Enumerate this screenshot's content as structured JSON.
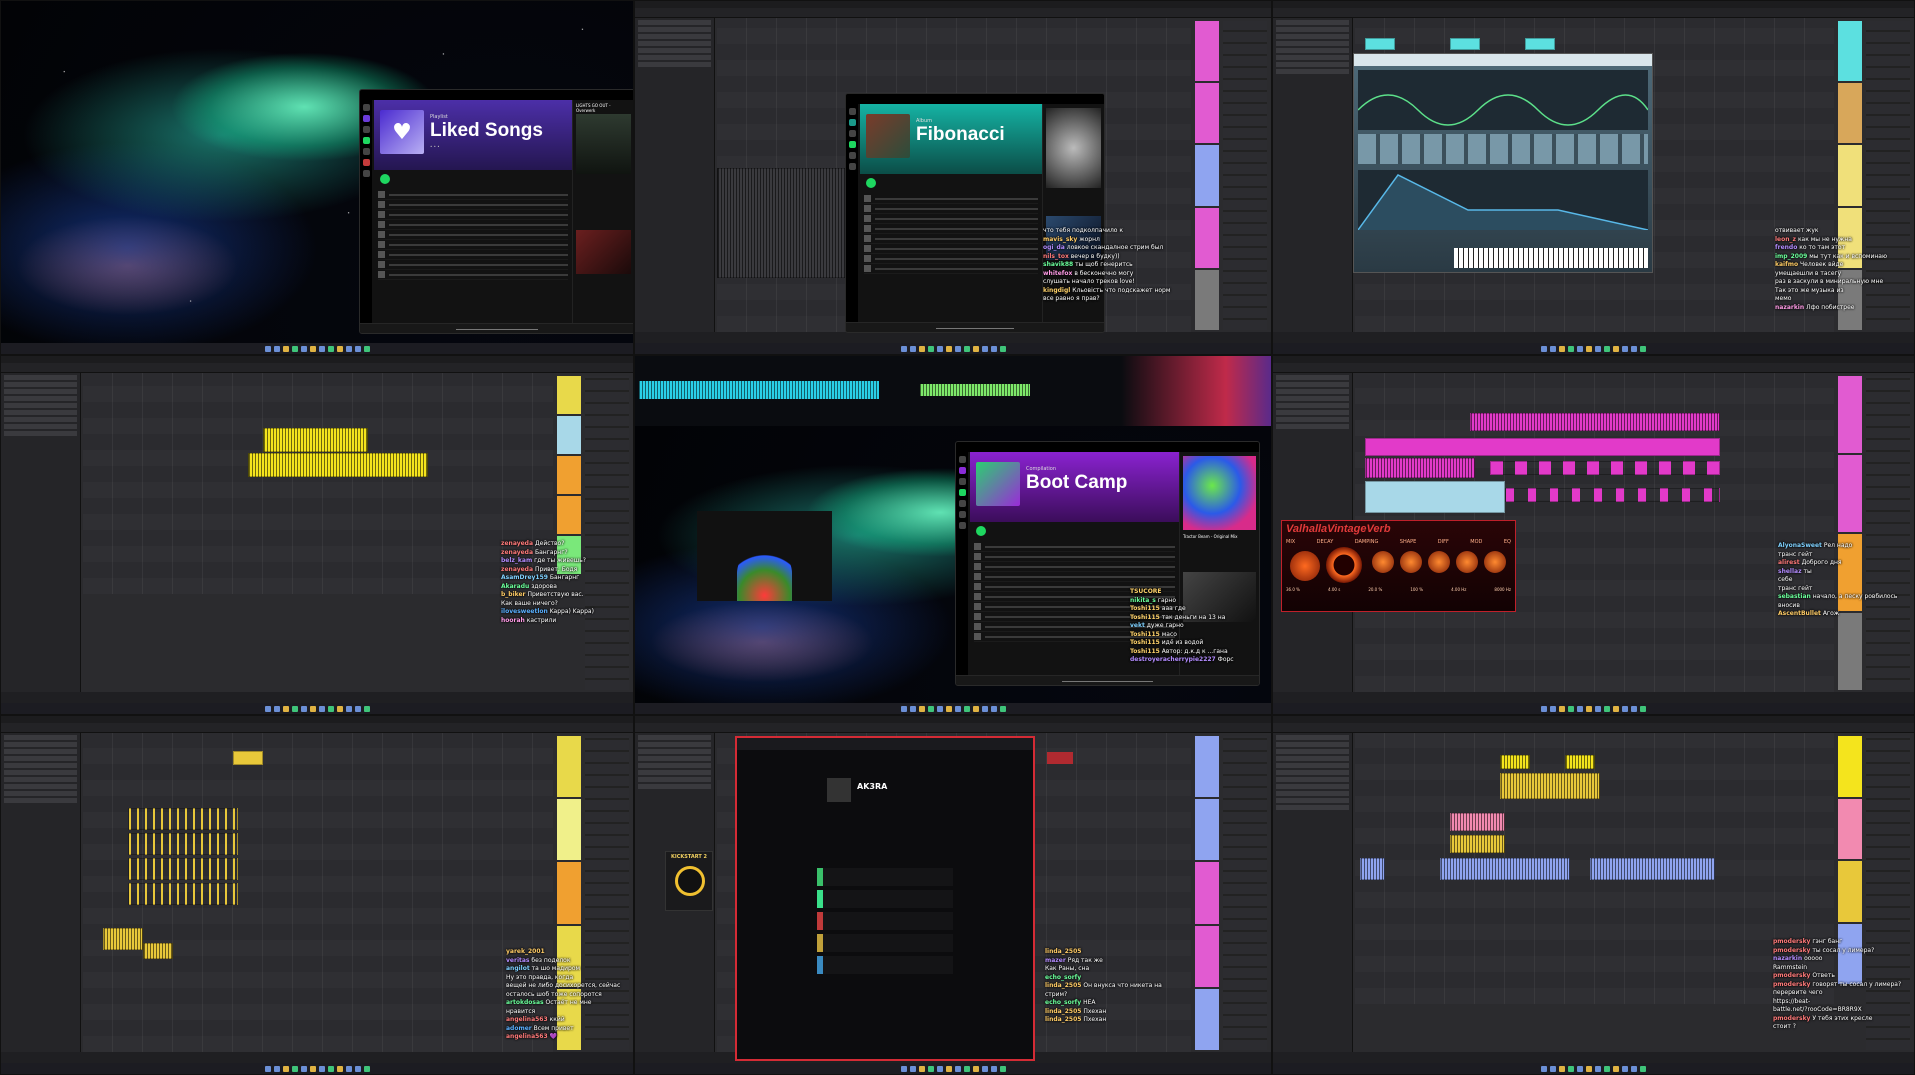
{
  "panels": {
    "p1": {
      "app_title": "Liked Songs",
      "side_title": "LIGHTS GO OUT - Overwerk"
    },
    "p2": {
      "app_title": "Fibonacci",
      "chat": [
        {
          "user": "",
          "text": "что тебя подколпачило к"
        },
        {
          "user": "mavis_sky",
          "text": "жорнл"
        },
        {
          "user": "ogi_da",
          "text": "ловкое скандалное стрим был"
        },
        {
          "user": "nils_tox",
          "text": "вечер в будку))"
        },
        {
          "user": "shavik88",
          "text": "ты щоб генеритсь"
        },
        {
          "user": "whitefox",
          "text": "в бесконечно могу"
        },
        {
          "user": "",
          "text": "слушать начало треков love!"
        },
        {
          "user": "kingdigl",
          "text": "Кльовість что подскажет норм"
        },
        {
          "user": "",
          "text": "все равно я прав?"
        }
      ]
    },
    "p3": {
      "chat": [
        {
          "user": "",
          "text": "отвивает жук"
        },
        {
          "user": "leon_z",
          "text": "как мы не нужна"
        },
        {
          "user": "frendo",
          "text": "ко то там этот"
        },
        {
          "user": "imp_2009",
          "text": "мы тут как и вспоминаю"
        },
        {
          "user": "kaifmo",
          "text": "Человек вйде"
        },
        {
          "user": "",
          "text": "умещаешли в тасегу"
        },
        {
          "user": "",
          "text": "раз в заскули в миниральную мне"
        },
        {
          "user": "",
          "text": "Так это же музыка из"
        },
        {
          "user": "",
          "text": "мемо"
        },
        {
          "user": "nazarkin",
          "text": "Лфо побистрее"
        }
      ]
    },
    "p4": {
      "chat": [
        {
          "user": "zenayeda",
          "text": "Действо?"
        },
        {
          "user": "zenayeda",
          "text": "Бангарнг?"
        },
        {
          "user": "belz_kam",
          "text": "где ты живешь?"
        },
        {
          "user": "zenayeda",
          "text": "Привет, Бодя"
        },
        {
          "user": "AsamDrey159",
          "text": "Бангарнг"
        },
        {
          "user": "Akaradu",
          "text": "здорова"
        },
        {
          "user": "b_biker",
          "text": "Приветствую вас."
        },
        {
          "user": "",
          "text": "Как ваше ничего?"
        },
        {
          "user": "ilovesweetlon",
          "text": "Kappa) Kappa)"
        },
        {
          "user": "hoorah",
          "text": "кастрили"
        }
      ]
    },
    "p5": {
      "app_title": "Boot Camp",
      "side_title": "Tractor Beam - Original Mix",
      "chat": [
        {
          "user": "TSUCORE",
          "text": ""
        },
        {
          "user": "nikita_s",
          "text": "гарно"
        },
        {
          "user": "Toshi115",
          "text": "ааа где"
        },
        {
          "user": "Toshi115",
          "text": "так деньги на 13 на"
        },
        {
          "user": "vekt",
          "text": "дуже гарно"
        },
        {
          "user": "Toshi115",
          "text": "масо"
        },
        {
          "user": "Toshi115",
          "text": "идё из водой"
        },
        {
          "user": "Toshi115",
          "text": "Автор: д.к.д к ...гана"
        },
        {
          "user": "destroyeracherrypie2227",
          "text": "Форс"
        }
      ]
    },
    "p6": {
      "plugin_title": "ValhallaVintageVerb",
      "plugin_params": [
        "MIX",
        "DECAY",
        "DAMPING",
        "SHAPE",
        "DIFF",
        "MOD",
        "EQ"
      ],
      "plugin_values": [
        "36.0 %",
        "4.00 s",
        "20.0 %",
        "100 %",
        "4.00 Hz",
        "8000 Hz"
      ],
      "chat": [
        {
          "user": "AlyonaSweet",
          "text": "Рел надо"
        },
        {
          "user": "",
          "text": "транс гейт"
        },
        {
          "user": "alirest",
          "text": "Доброго дня"
        },
        {
          "user": "shellaz",
          "text": "ты"
        },
        {
          "user": "",
          "text": "себе"
        },
        {
          "user": "",
          "text": "транс гейт"
        },
        {
          "user": "sebastian",
          "text": "начало, а песку ровбилось"
        },
        {
          "user": "",
          "text": "вносив"
        },
        {
          "user": "AscentBullet",
          "text": "Агож"
        }
      ]
    },
    "p7": {
      "chat": [
        {
          "user": "yarek_2001",
          "text": ""
        },
        {
          "user": "veritas",
          "text": "без поделок"
        },
        {
          "user": "angilot",
          "text": "та шо мадиром"
        },
        {
          "user": "",
          "text": "Ну это правда, когда"
        },
        {
          "user": "",
          "text": "вещей не либо досихорется, сейчас"
        },
        {
          "user": "",
          "text": "осталось шоб тоже сопоротся"
        },
        {
          "user": "artokdosas",
          "text": "Остаёт не мне"
        },
        {
          "user": "",
          "text": "нравится"
        },
        {
          "user": "angelina563",
          "text": "ккйй"
        },
        {
          "user": "adomer",
          "text": "Всем привет"
        },
        {
          "user": "angelina563",
          "text": "💜"
        }
      ]
    },
    "p8": {
      "app_title": "AK3RA",
      "plugin_title": "KICKSTART 2",
      "chat": [
        {
          "user": "linda_2505",
          "text": ""
        },
        {
          "user": "mazer",
          "text": "Ряд так же"
        },
        {
          "user": "",
          "text": "Как Раны, сна"
        },
        {
          "user": "echo_sorfy",
          "text": ""
        },
        {
          "user": "linda_2505",
          "text": "Он внукса что никета на"
        },
        {
          "user": "",
          "text": "стрим?"
        },
        {
          "user": "echo_sorfy",
          "text": "HEA"
        },
        {
          "user": "linda_2505",
          "text": "Пхехан"
        },
        {
          "user": "linda_2505",
          "text": "Пхехан"
        }
      ]
    },
    "p9": {
      "chat": [
        {
          "user": "pmodersky",
          "text": "гэнг банг"
        },
        {
          "user": "pmodersky",
          "text": "ты сосал у лимера?"
        },
        {
          "user": "nazarkin",
          "text": "ооооо"
        },
        {
          "user": "",
          "text": "Rammstein"
        },
        {
          "user": "pmodersky",
          "text": "Ответь"
        },
        {
          "user": "pmodersky",
          "text": "говорят ты сосал у лимера?"
        },
        {
          "user": "",
          "text": "перервите чего"
        },
        {
          "user": "",
          "text": "https://beat-"
        },
        {
          "user": "",
          "text": "battle.net/?rooCode=BR8R9X"
        },
        {
          "user": "pmodersky",
          "text": "У тебя этих кресле"
        },
        {
          "user": "",
          "text": "стоит ?"
        }
      ]
    }
  },
  "colors": {
    "yellow_clip": "#f4e41d",
    "pink_clip": "#e23ac9",
    "blue_clip": "#8fa4f0",
    "spotify_green": "#1ed760",
    "valhalla_red": "#c0202a"
  }
}
